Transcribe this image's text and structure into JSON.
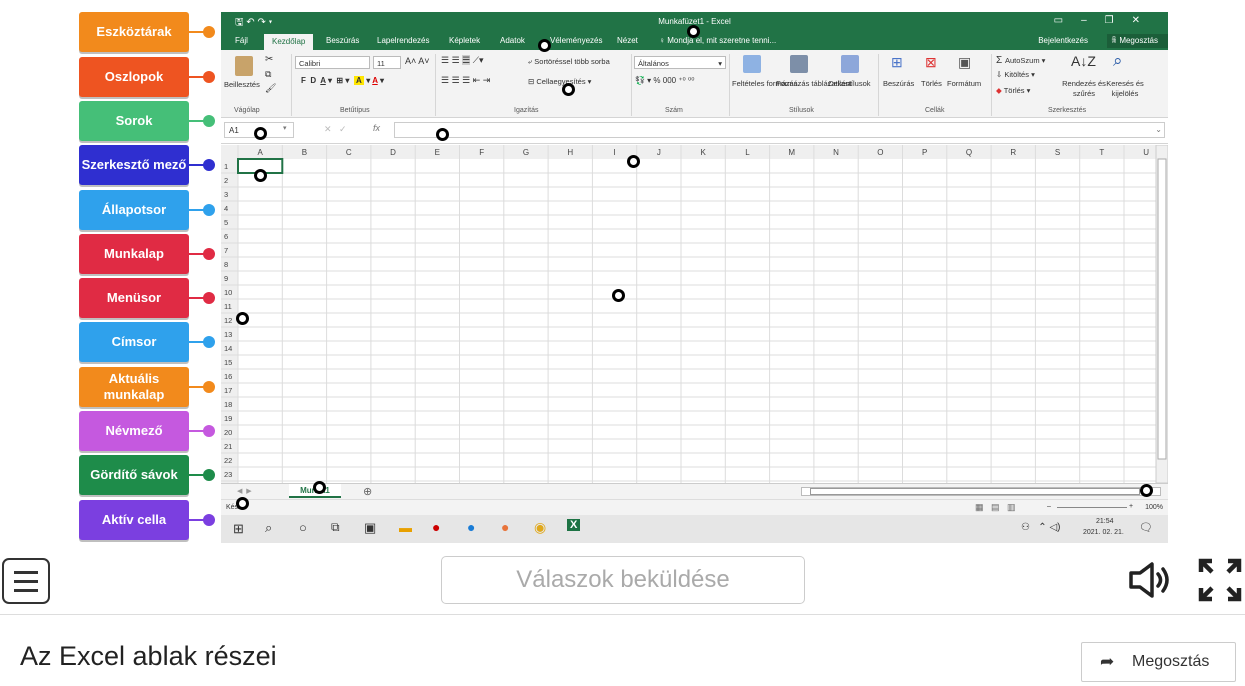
{
  "labels": [
    {
      "text": "Eszköztárak",
      "color": "#f28a1c"
    },
    {
      "text": "Oszlopok",
      "color": "#ee5421"
    },
    {
      "text": "Sorok",
      "color": "#45bf78"
    },
    {
      "text": "Szerkesztő mező",
      "color": "#2f2fd0"
    },
    {
      "text": "Állapotsor",
      "color": "#2fa1ec"
    },
    {
      "text": "Munkalap",
      "color": "#e02b44"
    },
    {
      "text": "Menüsor",
      "color": "#e02b44"
    },
    {
      "text": "Címsor",
      "color": "#2fa1ec"
    },
    {
      "text": "Aktuális munkalap",
      "color": "#f28a1c"
    },
    {
      "text": "Névmező",
      "color": "#c559df"
    },
    {
      "text": "Gördítő sávok",
      "color": "#1e8c4a"
    },
    {
      "text": "Aktív cella",
      "color": "#7b3fe0"
    }
  ],
  "excel": {
    "title": "Munkafüzet1 - Excel",
    "tabs": [
      "Fájl",
      "Kezdőlap",
      "Beszúrás",
      "Lapelrendezés",
      "Képletek",
      "Adatok",
      "Véleményezés",
      "Nézet"
    ],
    "tell_me": "Mondja el, mit szeretne tenni...",
    "signin": "Bejelentkezés",
    "share": "Megosztás",
    "ribbon": {
      "paste": "Beillesztés",
      "font_name": "Calibri",
      "font_size": "11",
      "wrap": "Sortöréssel több sorba",
      "merge": "Cellaegyesítés",
      "number_format": "Általános",
      "cond_format": "Feltételes formázás",
      "format_table": "Formázás táblázatként",
      "cell_styles": "Cellastílusok",
      "insert": "Beszúrás",
      "delete": "Törlés",
      "format": "Formátum",
      "autosum": "AutoSzum",
      "fill": "Kitöltés",
      "clear": "Törlés",
      "sort": "Rendezés és szűrés",
      "find": "Keresés és kijelölés",
      "groups": [
        "Vágólap",
        "Betűtípus",
        "Igazítás",
        "Szám",
        "Stílusok",
        "Cellák",
        "Szerkesztés"
      ]
    },
    "namebox": "A1",
    "fx": "fx",
    "columns": [
      "A",
      "B",
      "C",
      "D",
      "E",
      "F",
      "G",
      "H",
      "I",
      "J",
      "K",
      "L",
      "M",
      "N",
      "O",
      "P",
      "Q",
      "R",
      "S",
      "T",
      "U"
    ],
    "rows": [
      "1",
      "2",
      "3",
      "4",
      "5",
      "6",
      "7",
      "8",
      "9",
      "10",
      "11",
      "12",
      "13",
      "14",
      "15",
      "16",
      "17",
      "18",
      "19",
      "20",
      "21",
      "22",
      "23"
    ],
    "sheet_tab": "Munka1",
    "status_text": "Kész",
    "zoom": "100%",
    "clock_time": "21:54",
    "clock_date": "2021. 02. 21."
  },
  "bottom": {
    "submit": "Válaszok beküldése",
    "page_title": "Az Excel ablak részei",
    "share_button": "Megosztás"
  }
}
